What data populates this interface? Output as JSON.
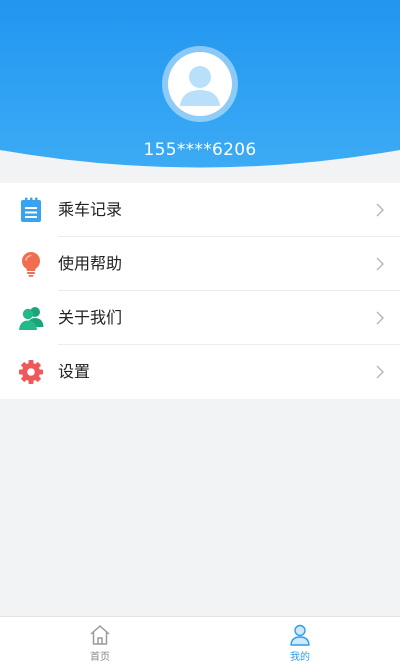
{
  "colors": {
    "header_top": "#2196f0",
    "header_bottom": "#3cabf5",
    "accent": "#2b9ef0",
    "icon_record": "#3aa3ef",
    "icon_help": "#f06d4f",
    "icon_about": "#23b98a",
    "icon_settings": "#ee5a5a"
  },
  "profile": {
    "phone": "155****6206",
    "avatar_icon": "user-avatar-icon"
  },
  "menu": {
    "items": [
      {
        "label": "乘车记录",
        "icon": "clipboard-icon"
      },
      {
        "label": "使用帮助",
        "icon": "lightbulb-icon"
      },
      {
        "label": "关于我们",
        "icon": "people-icon"
      },
      {
        "label": "设置",
        "icon": "gear-icon"
      }
    ]
  },
  "tabbar": {
    "tabs": [
      {
        "label": "首页",
        "icon": "home-icon",
        "active": false
      },
      {
        "label": "我的",
        "icon": "user-icon",
        "active": true
      }
    ]
  }
}
